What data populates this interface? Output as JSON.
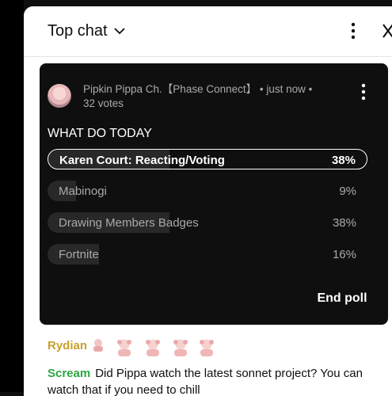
{
  "chat_header": {
    "title": "Top chat"
  },
  "poll": {
    "author": "Pipkin Pippa Ch.【Phase Connect】",
    "meta_time": "• just now •",
    "votes": "32 votes",
    "question": "WHAT DO TODAY",
    "options": [
      {
        "label": "Karen Court: Reacting/Voting",
        "percent": "38%",
        "fraction": 0.38,
        "selected": true
      },
      {
        "label": "Mabinogi",
        "percent": "9%",
        "fraction": 0.09,
        "selected": false
      },
      {
        "label": "Drawing Members Badges",
        "percent": "38%",
        "fraction": 0.38,
        "selected": false
      },
      {
        "label": "Fortnite",
        "percent": "16%",
        "fraction": 0.16,
        "selected": false
      }
    ],
    "end_poll_label": "End poll"
  },
  "messages": [
    {
      "author": "Rydian",
      "author_color": "#c8a02b",
      "emoji_count": 4
    },
    {
      "author": "Scream",
      "author_color": "#2ba640",
      "text": "Did Pippa watch the latest sonnet project? You can watch that if you need to chill"
    }
  ],
  "colors": {
    "poll_background": "#0f0f0f",
    "poll_bar_fill": "#282828",
    "panel_background": "#ffffff"
  },
  "icons": [
    "chevron-down-icon",
    "more-vert-icon",
    "close-icon",
    "avatar-image",
    "emote-icon"
  ]
}
